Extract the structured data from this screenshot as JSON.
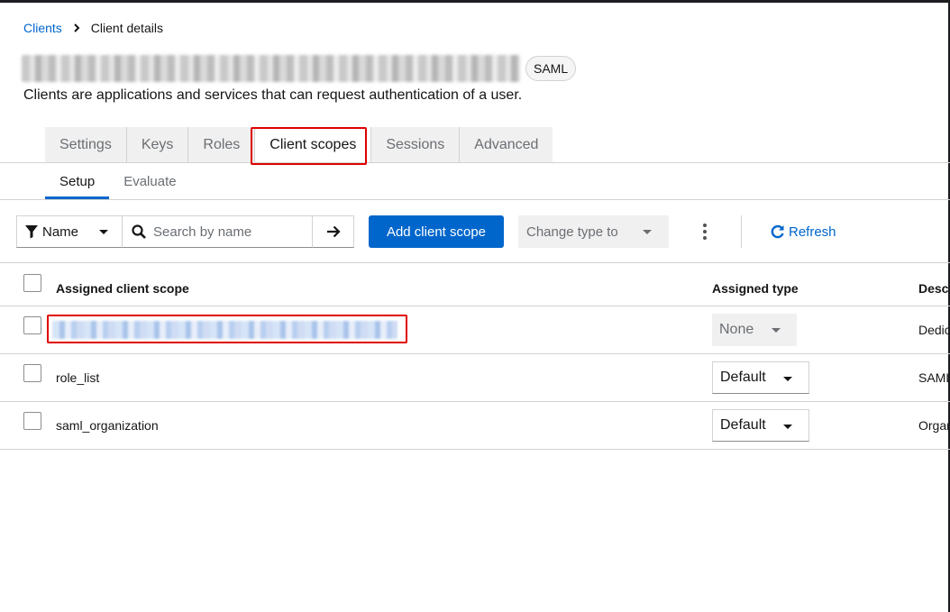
{
  "breadcrumb": {
    "parent": "Clients",
    "current": "Client details"
  },
  "header": {
    "badge": "SAML",
    "subtitle": "Clients are applications and services that can request authentication of a user."
  },
  "tabs": [
    {
      "label": "Settings"
    },
    {
      "label": "Keys"
    },
    {
      "label": "Roles"
    },
    {
      "label": "Client scopes",
      "active": true
    },
    {
      "label": "Sessions"
    },
    {
      "label": "Advanced"
    }
  ],
  "subtabs": [
    {
      "label": "Setup",
      "active": true
    },
    {
      "label": "Evaluate"
    }
  ],
  "toolbar": {
    "filter_label": "Name",
    "search_placeholder": "Search by name",
    "add_label": "Add client scope",
    "change_type_label": "Change type to",
    "refresh_label": "Refresh"
  },
  "table": {
    "columns": [
      "Assigned client scope",
      "Assigned type",
      "Descr"
    ],
    "rows": [
      {
        "scope": "",
        "type": "None",
        "description": "Dedic"
      },
      {
        "scope": "role_list",
        "type": "Default",
        "description": "SAML"
      },
      {
        "scope": "saml_organization",
        "type": "Default",
        "description": "Organ"
      }
    ]
  },
  "colors": {
    "accent": "#0066cc",
    "highlight": "#e00000",
    "text": "#151515",
    "muted": "#6a6e73"
  }
}
